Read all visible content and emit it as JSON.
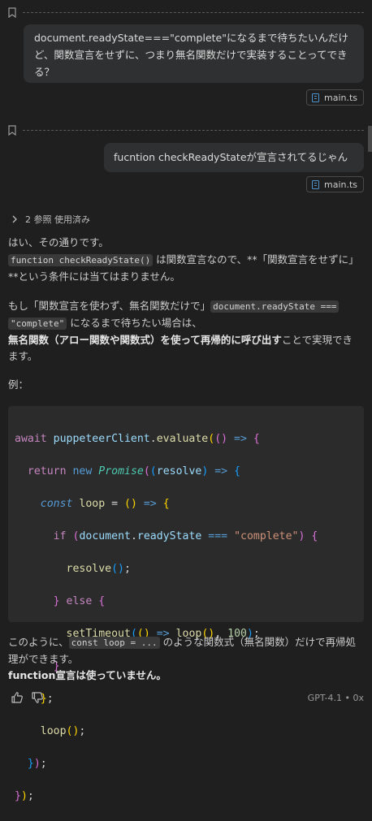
{
  "messages": [
    {
      "role": "user",
      "text": "document.readyState===\"complete\"になるまで待ちたいんだけど、関数宣言をせずに、つまり無名関数だけで実装することってできる？",
      "attachment": "main.ts"
    },
    {
      "role": "user",
      "text": "fucntion checkReadyStateが宣言されてるじゃん",
      "attachment": "main.ts"
    }
  ],
  "references": {
    "label": "2 参照 使用済み"
  },
  "answer": {
    "line1": "はい、その通りです。",
    "p1_code": "function checkReadyState()",
    "p1_text": " は関数宣言なので、**「関数宣言をせずに」**という条件には当てはまりません。",
    "p2_a": "もし「関数宣言を使わず、無名関数だけで」",
    "p2_code1": "document.readyState ===",
    "p2_code2": "\"complete\"",
    "p2_b": " になるまで待ちたい場合は、",
    "p2_bold": "無名関数（アロー関数や関数式）を使って再帰的に呼び出す",
    "p2_c": "ことで実現できます。",
    "example_label": "例：",
    "code_lines": [
      "await puppeteerClient.evaluate(() => {",
      "  return new Promise((resolve) => {",
      "    const loop = () => {",
      "      if (document.readyState === \"complete\") {",
      "        resolve();",
      "      } else {",
      "        setTimeout(() => loop(), 100);",
      "      }",
      "    };",
      "    loop();",
      "  });",
      "});"
    ],
    "p3_a": "このように、",
    "p3_code": "const loop = ...",
    "p3_b": " のような関数式（無名関数）だけで再帰処理ができます。",
    "p3_bold": "function宣言は使っていません。"
  },
  "footer": {
    "model": "GPT-4.1 • 0x",
    "thumbs_up_icon": "thumbs-up-icon",
    "thumbs_down_icon": "thumbs-down-icon"
  }
}
